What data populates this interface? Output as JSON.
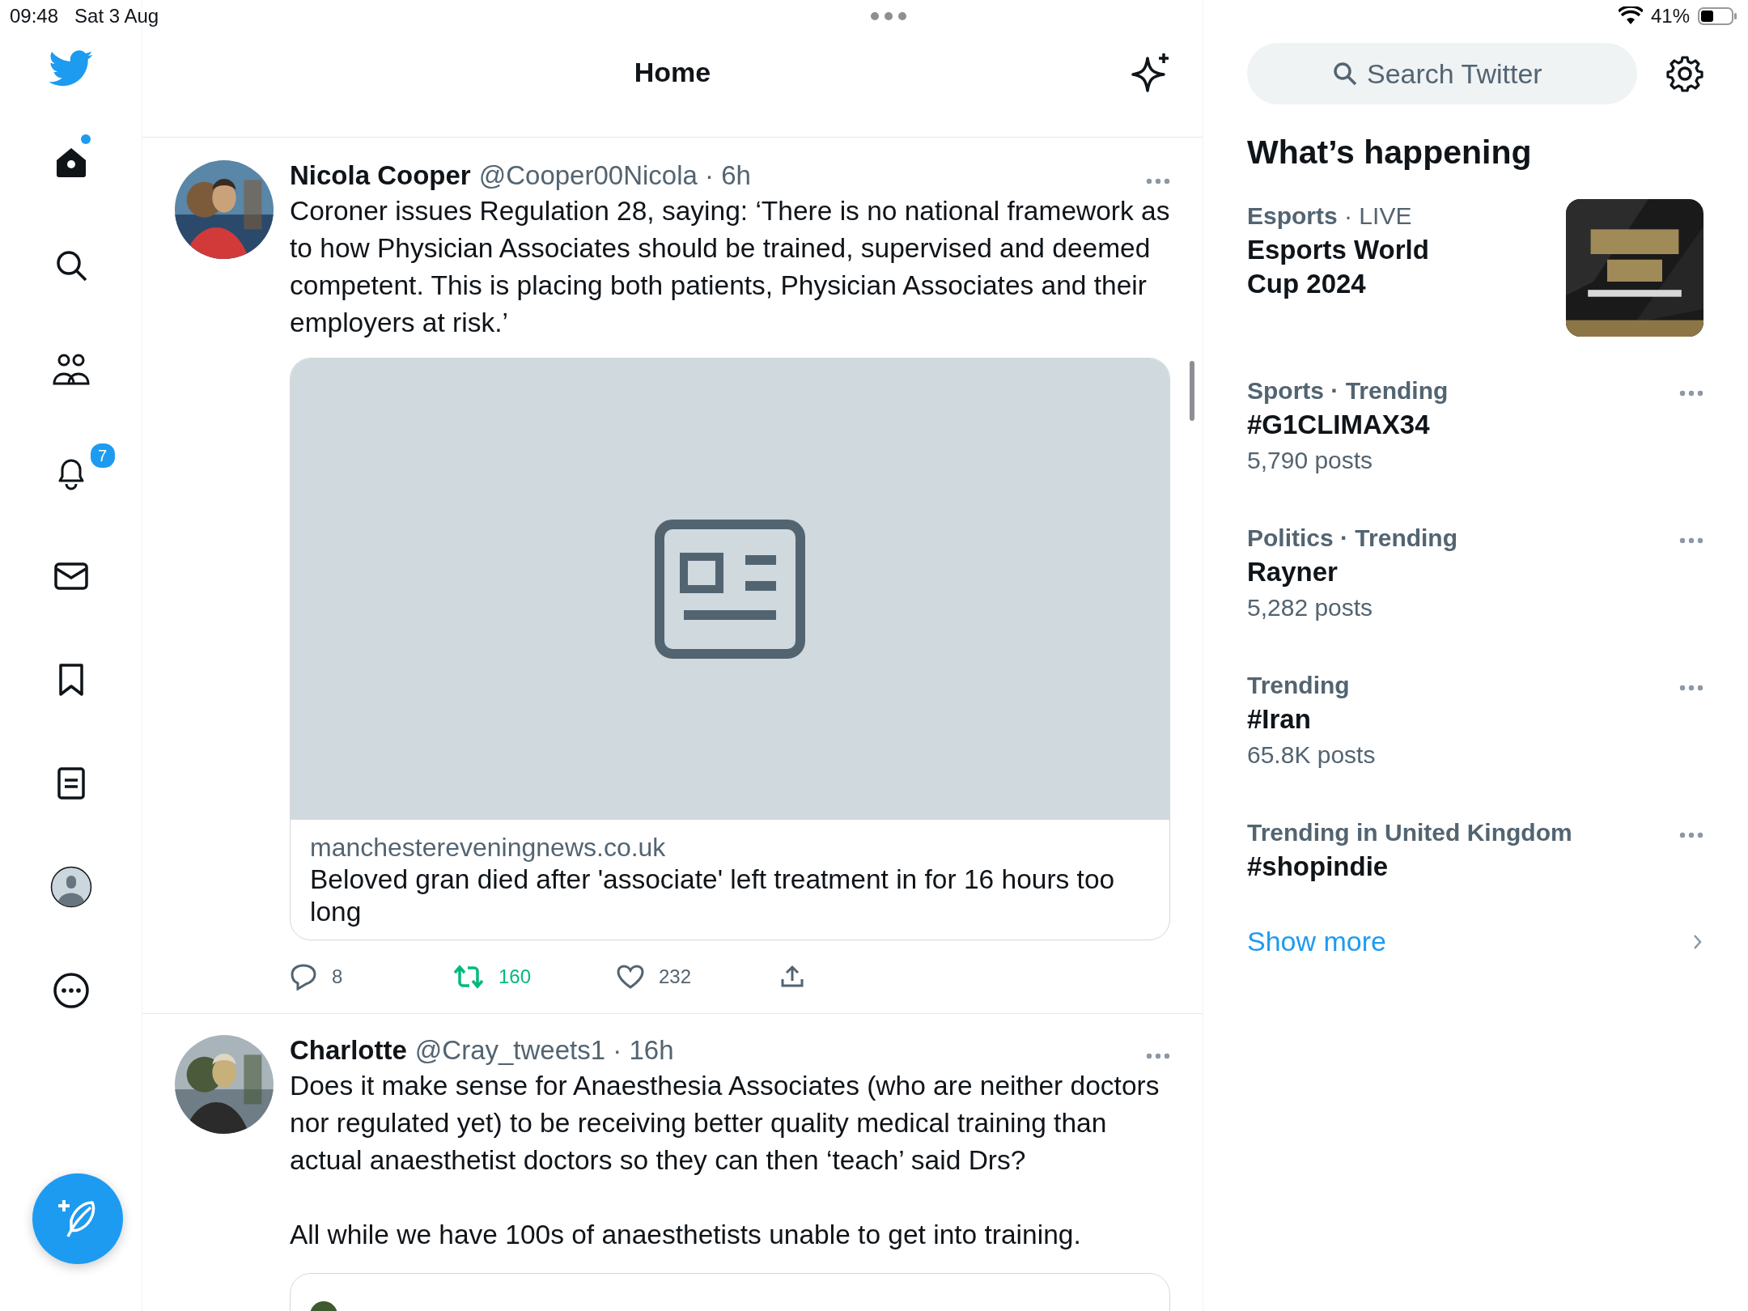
{
  "status_bar": {
    "time": "09:48",
    "date": "Sat 3 Aug",
    "battery": "41%"
  },
  "nav": {
    "items": [
      {
        "kind": "home",
        "dot": true
      },
      {
        "kind": "search",
        "dot": false
      },
      {
        "kind": "communities",
        "dot": false
      },
      {
        "kind": "notifications",
        "dot": false,
        "badge": "7"
      },
      {
        "kind": "messages",
        "dot": false
      },
      {
        "kind": "bookmarks",
        "dot": false
      },
      {
        "kind": "lists",
        "dot": false
      },
      {
        "kind": "profile",
        "dot": false
      },
      {
        "kind": "more",
        "dot": false
      }
    ]
  },
  "header": {
    "title": "Home"
  },
  "tweets": [
    {
      "name": "Nicola Cooper",
      "meta": "@Cooper00Nicola · 6h",
      "paragraphs": [
        "Coroner issues Regulation 28, saying: ‘There is no national framework as to how Physician Associates should be trained, supervised and deemed competent. This is placing both patients, Physician Associates and their employers at risk.’"
      ],
      "card": {
        "domain": "manchestereveningnews.co.uk",
        "title": "Beloved gran died after 'associate' left treatment in for 16 hours too long"
      },
      "actions": {
        "replies": "8",
        "retweets": "160",
        "retweeted": true,
        "likes": "232",
        "liked": false
      }
    },
    {
      "name": "Charlotte",
      "meta": "@Cray_tweets1 · 16h",
      "paragraphs": [
        "Does it make sense for Anaesthesia Associates (who are neither doctors nor regulated yet) to be receiving better quality medical training than actual anaesthetist doctors so they can then ‘teach’ said Drs?",
        "All while we have 100s of anaesthetists unable to get into training."
      ],
      "quoted": {
        "kind": "quote"
      }
    }
  ],
  "sidebar": {
    "search": {
      "placeholder": "Search Twitter"
    },
    "title": "What’s happening",
    "trends": [
      {
        "kind": "event",
        "category": "Esports",
        "status": "· LIVE",
        "title": "Esports World Cup 2024"
      },
      {
        "kind": "trend",
        "context": "Sports · Trending",
        "title": "#G1CLIMAX34",
        "count": "5,790 posts"
      },
      {
        "kind": "trend",
        "context": "Politics · Trending",
        "title": "Rayner",
        "count": "5,282 posts"
      },
      {
        "kind": "trend",
        "context": "Trending",
        "title": "#Iran",
        "count": "65.8K posts"
      },
      {
        "kind": "trend",
        "context": "Trending in United Kingdom",
        "title": "#shopindie"
      }
    ],
    "show_more": "Show more"
  }
}
